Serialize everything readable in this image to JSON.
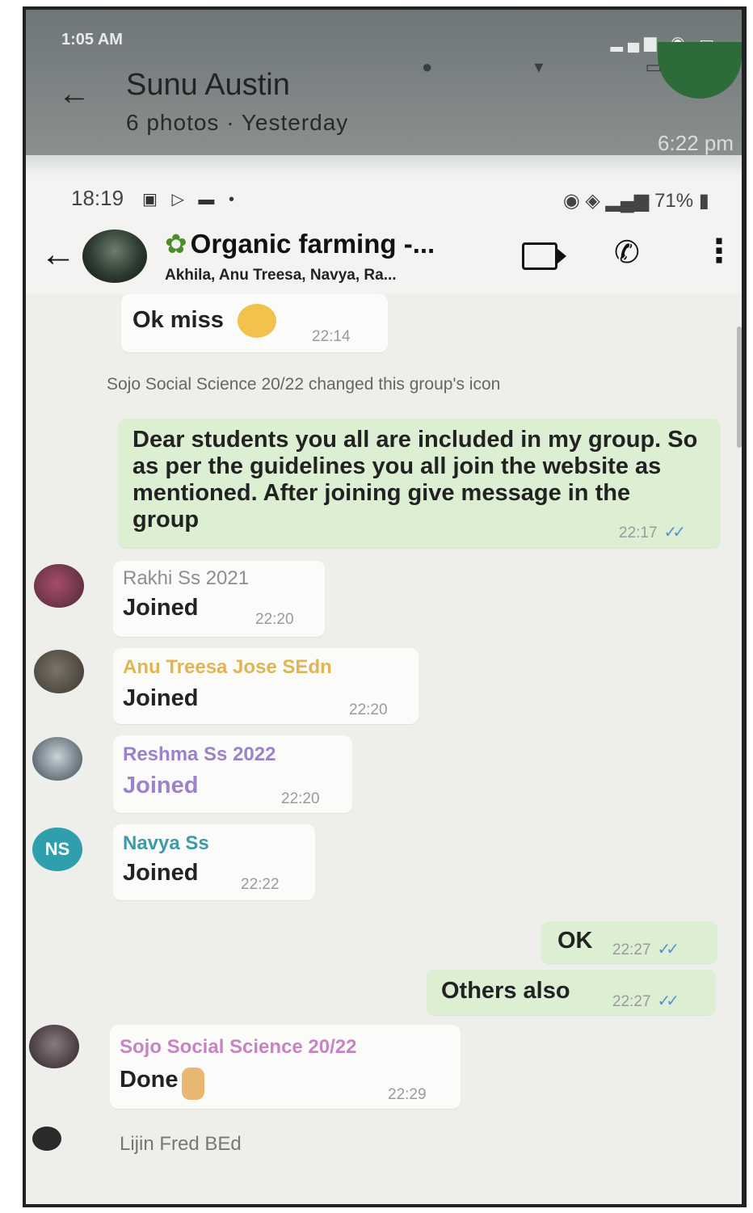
{
  "outer": {
    "status_time": "1:05 AM",
    "contact_name": "Sunu Austin",
    "subtitle": "6 photos · Yesterday",
    "time_right": "6:22 pm"
  },
  "status_bar": {
    "time": "18:19",
    "battery": "71%"
  },
  "header": {
    "group_name": "Organic farming -...",
    "members": "Akhila, Anu Treesa, Navya, Ra..."
  },
  "messages": {
    "m1": {
      "text": "Ok miss",
      "time": "22:14"
    },
    "system": "Sojo Social Science 20/22 changed this group's icon",
    "m2": {
      "text": "Dear students you all are included in my group. So as per the guidelines you all join the website as mentioned. After joining give message in the group",
      "time": "22:17"
    },
    "m3": {
      "sender": "Rakhi Ss 2021",
      "text": "Joined",
      "time": "22:20"
    },
    "m4": {
      "sender": "Anu Treesa Jose SEdn",
      "text": "Joined",
      "time": "22:20"
    },
    "m5": {
      "sender": "Reshma Ss 2022",
      "text": "Joined",
      "time": "22:20"
    },
    "m6": {
      "sender": "Navya Ss",
      "text": "Joined",
      "time": "22:22",
      "avatar_initials": "NS"
    },
    "m7": {
      "text": "OK",
      "time": "22:27"
    },
    "m8": {
      "text": "Others also",
      "time": "22:27"
    },
    "m9": {
      "sender": "Sojo Social Science 20/22",
      "text": "Done",
      "time": "22:29"
    },
    "m10": {
      "sender": "Lijin Fred BEd"
    }
  },
  "colors": {
    "outgoing_bubble": "#dcefd3",
    "read_ticks": "#5a8fd0",
    "sender_anu": "#e0b552",
    "sender_reshma": "#9b82c9",
    "sender_navya": "#3d9aa8",
    "sender_sojo": "#c784c2",
    "sender_rakhi": "#8e8e8e"
  },
  "icons": [
    "back-arrow-icon",
    "video-call-icon",
    "voice-call-icon",
    "more-options-icon",
    "sprout-icon",
    "double-tick-icon"
  ]
}
